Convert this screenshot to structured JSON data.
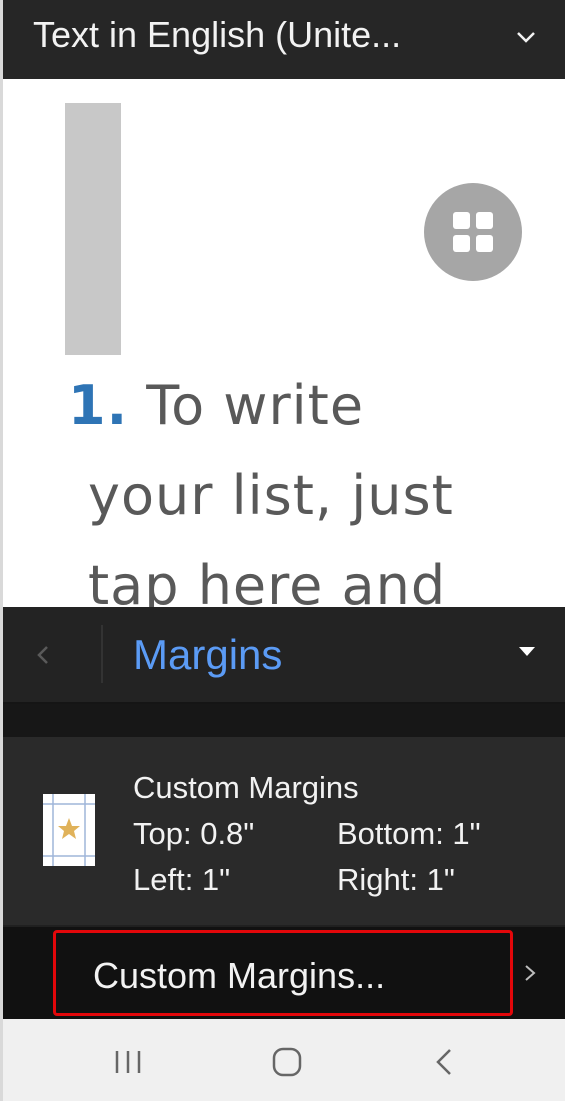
{
  "topbar": {
    "title": "Text in English (Unite...",
    "chevron_icon": "chevron-down-icon"
  },
  "document": {
    "list_number": "1.",
    "lines": [
      "To write",
      "your list, just",
      "tap here and"
    ],
    "fab_icon": "grid-icon"
  },
  "pane": {
    "back_icon": "chevron-left-icon",
    "title": "Margins",
    "dropdown_icon": "caret-down-icon",
    "option": {
      "title": "Custom Margins",
      "top": "Top: 0.8\"",
      "bottom": "Bottom: 1\"",
      "left": "Left: 1\"",
      "right": "Right: 1\""
    },
    "custom_button": "Custom Margins..."
  },
  "navbar": {
    "recent_icon": "recent-apps-icon",
    "home_icon": "home-icon",
    "back_icon": "back-icon"
  },
  "colors": {
    "accent": "#5b9bf5",
    "list_number": "#2e74b5",
    "highlight_border": "#e3070a"
  }
}
